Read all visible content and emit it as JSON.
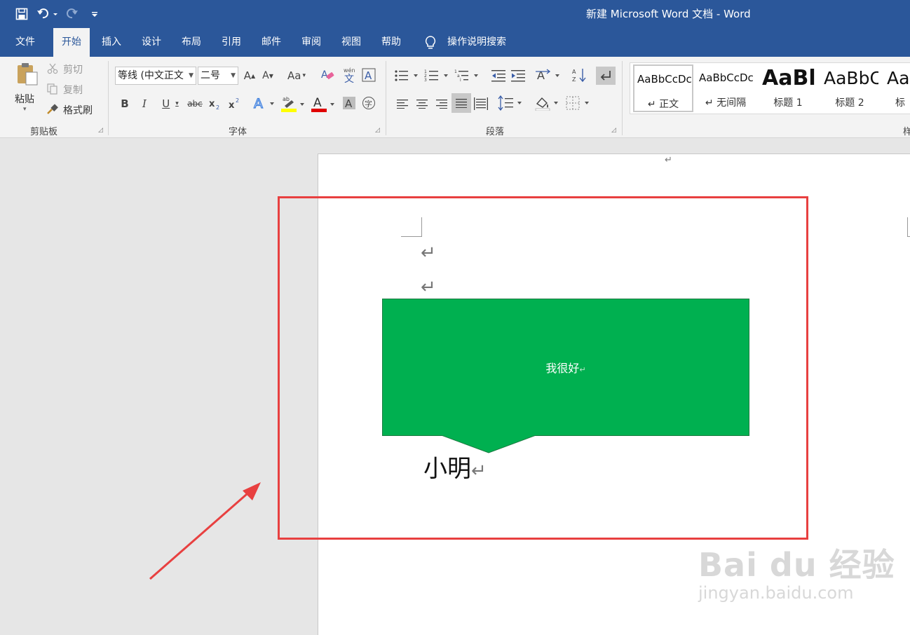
{
  "window": {
    "title": "新建 Microsoft Word 文档  -  Word"
  },
  "qat": {
    "save_icon": "save-icon",
    "undo_icon": "undo-icon",
    "redo_icon": "redo-icon",
    "customize_icon": "customize-qat-icon"
  },
  "tabs": [
    {
      "label": "文件"
    },
    {
      "label": "开始"
    },
    {
      "label": "插入"
    },
    {
      "label": "设计"
    },
    {
      "label": "布局"
    },
    {
      "label": "引用"
    },
    {
      "label": "邮件"
    },
    {
      "label": "审阅"
    },
    {
      "label": "视图"
    },
    {
      "label": "帮助"
    }
  ],
  "tell_me": {
    "label": "操作说明搜索"
  },
  "clipboard": {
    "paste": "粘贴",
    "cut": "剪切",
    "copy": "复制",
    "format_painter": "格式刷",
    "group": "剪贴板"
  },
  "font": {
    "name": "等线 (中文正文",
    "size": "二号",
    "grow": "A",
    "shrink": "A",
    "case": "Aa",
    "bold": "B",
    "italic": "I",
    "underline": "U",
    "strike": "abc",
    "group": "字体"
  },
  "paragraph": {
    "group": "段落"
  },
  "styles": {
    "items": [
      {
        "sample": "AaBbCcDc",
        "name": "↵ 正文"
      },
      {
        "sample": "AaBbCcDc",
        "name": "↵ 无间隔"
      },
      {
        "sample": "AaBl",
        "name": "标题 1"
      },
      {
        "sample": "AaBbC",
        "name": "标题 2"
      },
      {
        "sample": "Aa",
        "name": "标"
      }
    ],
    "group_partial": "样"
  },
  "document": {
    "pilcrow": "↵",
    "callout_text": "我很好",
    "callout_color": "#00b050",
    "name_text": "小明"
  },
  "annotation": {
    "box_color": "#e84040"
  },
  "watermark": {
    "brand": "Bai du 经验",
    "url": "jingyan.baidu.com"
  }
}
